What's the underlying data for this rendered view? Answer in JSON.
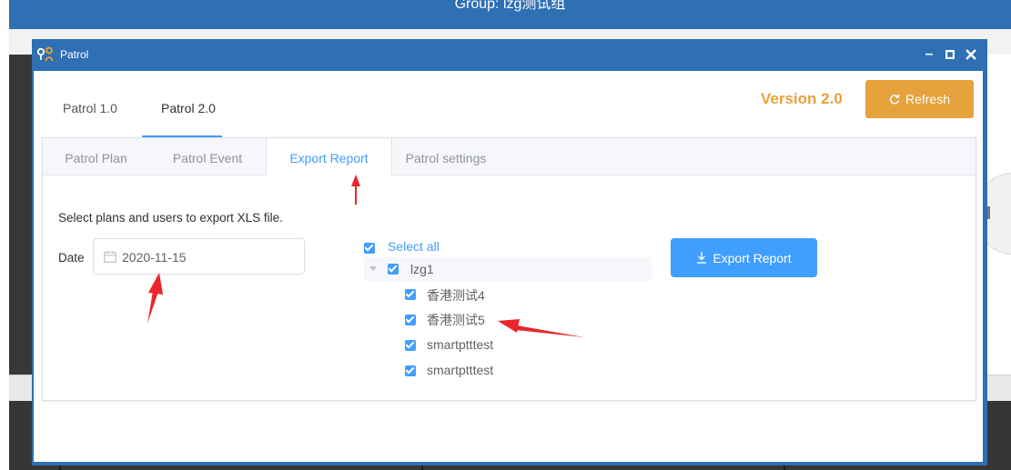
{
  "background": {
    "header_text": "Group: lzg测试组"
  },
  "window": {
    "title": "Patrol",
    "app_icon": "patrol-people-icon",
    "minimize_icon": "minimize-icon",
    "maximize_icon": "maximize-icon",
    "close_icon": "close-icon"
  },
  "top_tabs": [
    {
      "label": "Patrol 1.0",
      "active": false
    },
    {
      "label": "Patrol 2.0",
      "active": true
    }
  ],
  "version_label": "Version 2.0",
  "refresh_button": {
    "label": "Refresh",
    "icon": "refresh-icon"
  },
  "sub_tabs": [
    {
      "label": "Patrol Plan",
      "active": false
    },
    {
      "label": "Patrol Event",
      "active": false
    },
    {
      "label": "Export Report",
      "active": true
    },
    {
      "label": "Patrol settings",
      "active": false
    }
  ],
  "instruction": "Select plans and users to export XLS file.",
  "date": {
    "label": "Date",
    "value": "2020-11-15",
    "icon": "calendar-icon"
  },
  "tree": {
    "select_all": {
      "label": "Select all",
      "checked": true
    },
    "group": {
      "label": "lzg1",
      "checked": true,
      "expanded": true
    },
    "users": [
      {
        "label": "香港测试4",
        "checked": true
      },
      {
        "label": "香港测试5",
        "checked": true
      },
      {
        "label": "smartptttest",
        "checked": true
      },
      {
        "label": "smartptttest",
        "checked": true
      }
    ]
  },
  "export_button": {
    "label": "Export Report",
    "icon": "download-icon"
  },
  "colors": {
    "title_bar": "#2f6fb4",
    "accent_blue": "#409eff",
    "version_orange": "#e6a23c",
    "annotation_red": "#e8262b"
  }
}
